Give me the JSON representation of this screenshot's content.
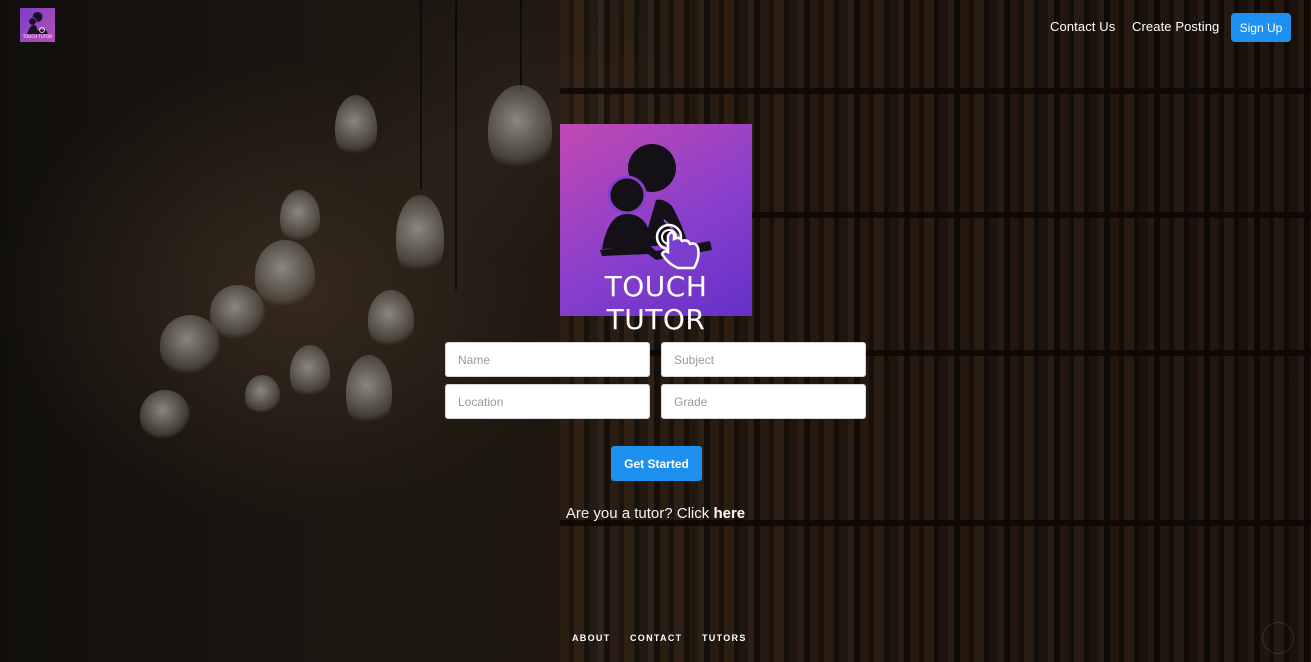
{
  "brand": {
    "icon": "touch-tutor-logo",
    "small_logo_text": "TOUCH TUTOR",
    "hero_logo_text": "TOUCH TUTOR",
    "gradient_colors": [
      "#c149b1",
      "#8a3fcc",
      "#6430c8"
    ]
  },
  "nav": {
    "contact_label": "Contact Us",
    "create_posting_label": "Create Posting",
    "signup_label": "Sign Up",
    "accent_color": "#1e90f0"
  },
  "form": {
    "name_placeholder": "Name",
    "subject_placeholder": "Subject",
    "location_placeholder": "Location",
    "grade_placeholder": "Grade",
    "submit_label": "Get Started"
  },
  "tutor_prompt": {
    "text": "Are you a tutor? Click ",
    "link_label": "here"
  },
  "footer": {
    "links": [
      "ABOUT",
      "CONTACT",
      "TUTORS"
    ]
  },
  "background": {
    "description_icon": "library-bookshelves-background"
  }
}
